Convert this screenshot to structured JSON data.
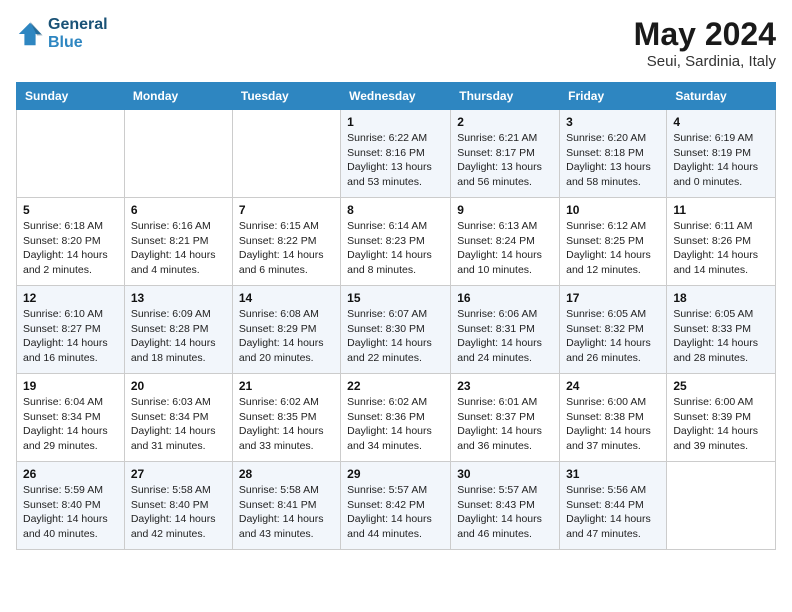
{
  "header": {
    "logo_line1": "General",
    "logo_line2": "Blue",
    "month_year": "May 2024",
    "location": "Seui, Sardinia, Italy"
  },
  "days_of_week": [
    "Sunday",
    "Monday",
    "Tuesday",
    "Wednesday",
    "Thursday",
    "Friday",
    "Saturday"
  ],
  "weeks": [
    [
      null,
      null,
      null,
      {
        "day": 1,
        "sunrise": "6:22 AM",
        "sunset": "8:16 PM",
        "daylight": "13 hours and 53 minutes."
      },
      {
        "day": 2,
        "sunrise": "6:21 AM",
        "sunset": "8:17 PM",
        "daylight": "13 hours and 56 minutes."
      },
      {
        "day": 3,
        "sunrise": "6:20 AM",
        "sunset": "8:18 PM",
        "daylight": "13 hours and 58 minutes."
      },
      {
        "day": 4,
        "sunrise": "6:19 AM",
        "sunset": "8:19 PM",
        "daylight": "14 hours and 0 minutes."
      }
    ],
    [
      {
        "day": 5,
        "sunrise": "6:18 AM",
        "sunset": "8:20 PM",
        "daylight": "14 hours and 2 minutes."
      },
      {
        "day": 6,
        "sunrise": "6:16 AM",
        "sunset": "8:21 PM",
        "daylight": "14 hours and 4 minutes."
      },
      {
        "day": 7,
        "sunrise": "6:15 AM",
        "sunset": "8:22 PM",
        "daylight": "14 hours and 6 minutes."
      },
      {
        "day": 8,
        "sunrise": "6:14 AM",
        "sunset": "8:23 PM",
        "daylight": "14 hours and 8 minutes."
      },
      {
        "day": 9,
        "sunrise": "6:13 AM",
        "sunset": "8:24 PM",
        "daylight": "14 hours and 10 minutes."
      },
      {
        "day": 10,
        "sunrise": "6:12 AM",
        "sunset": "8:25 PM",
        "daylight": "14 hours and 12 minutes."
      },
      {
        "day": 11,
        "sunrise": "6:11 AM",
        "sunset": "8:26 PM",
        "daylight": "14 hours and 14 minutes."
      }
    ],
    [
      {
        "day": 12,
        "sunrise": "6:10 AM",
        "sunset": "8:27 PM",
        "daylight": "14 hours and 16 minutes."
      },
      {
        "day": 13,
        "sunrise": "6:09 AM",
        "sunset": "8:28 PM",
        "daylight": "14 hours and 18 minutes."
      },
      {
        "day": 14,
        "sunrise": "6:08 AM",
        "sunset": "8:29 PM",
        "daylight": "14 hours and 20 minutes."
      },
      {
        "day": 15,
        "sunrise": "6:07 AM",
        "sunset": "8:30 PM",
        "daylight": "14 hours and 22 minutes."
      },
      {
        "day": 16,
        "sunrise": "6:06 AM",
        "sunset": "8:31 PM",
        "daylight": "14 hours and 24 minutes."
      },
      {
        "day": 17,
        "sunrise": "6:05 AM",
        "sunset": "8:32 PM",
        "daylight": "14 hours and 26 minutes."
      },
      {
        "day": 18,
        "sunrise": "6:05 AM",
        "sunset": "8:33 PM",
        "daylight": "14 hours and 28 minutes."
      }
    ],
    [
      {
        "day": 19,
        "sunrise": "6:04 AM",
        "sunset": "8:34 PM",
        "daylight": "14 hours and 29 minutes."
      },
      {
        "day": 20,
        "sunrise": "6:03 AM",
        "sunset": "8:34 PM",
        "daylight": "14 hours and 31 minutes."
      },
      {
        "day": 21,
        "sunrise": "6:02 AM",
        "sunset": "8:35 PM",
        "daylight": "14 hours and 33 minutes."
      },
      {
        "day": 22,
        "sunrise": "6:02 AM",
        "sunset": "8:36 PM",
        "daylight": "14 hours and 34 minutes."
      },
      {
        "day": 23,
        "sunrise": "6:01 AM",
        "sunset": "8:37 PM",
        "daylight": "14 hours and 36 minutes."
      },
      {
        "day": 24,
        "sunrise": "6:00 AM",
        "sunset": "8:38 PM",
        "daylight": "14 hours and 37 minutes."
      },
      {
        "day": 25,
        "sunrise": "6:00 AM",
        "sunset": "8:39 PM",
        "daylight": "14 hours and 39 minutes."
      }
    ],
    [
      {
        "day": 26,
        "sunrise": "5:59 AM",
        "sunset": "8:40 PM",
        "daylight": "14 hours and 40 minutes."
      },
      {
        "day": 27,
        "sunrise": "5:58 AM",
        "sunset": "8:40 PM",
        "daylight": "14 hours and 42 minutes."
      },
      {
        "day": 28,
        "sunrise": "5:58 AM",
        "sunset": "8:41 PM",
        "daylight": "14 hours and 43 minutes."
      },
      {
        "day": 29,
        "sunrise": "5:57 AM",
        "sunset": "8:42 PM",
        "daylight": "14 hours and 44 minutes."
      },
      {
        "day": 30,
        "sunrise": "5:57 AM",
        "sunset": "8:43 PM",
        "daylight": "14 hours and 46 minutes."
      },
      {
        "day": 31,
        "sunrise": "5:56 AM",
        "sunset": "8:44 PM",
        "daylight": "14 hours and 47 minutes."
      },
      null
    ]
  ],
  "labels": {
    "sunrise": "Sunrise:",
    "sunset": "Sunset:",
    "daylight": "Daylight:"
  }
}
